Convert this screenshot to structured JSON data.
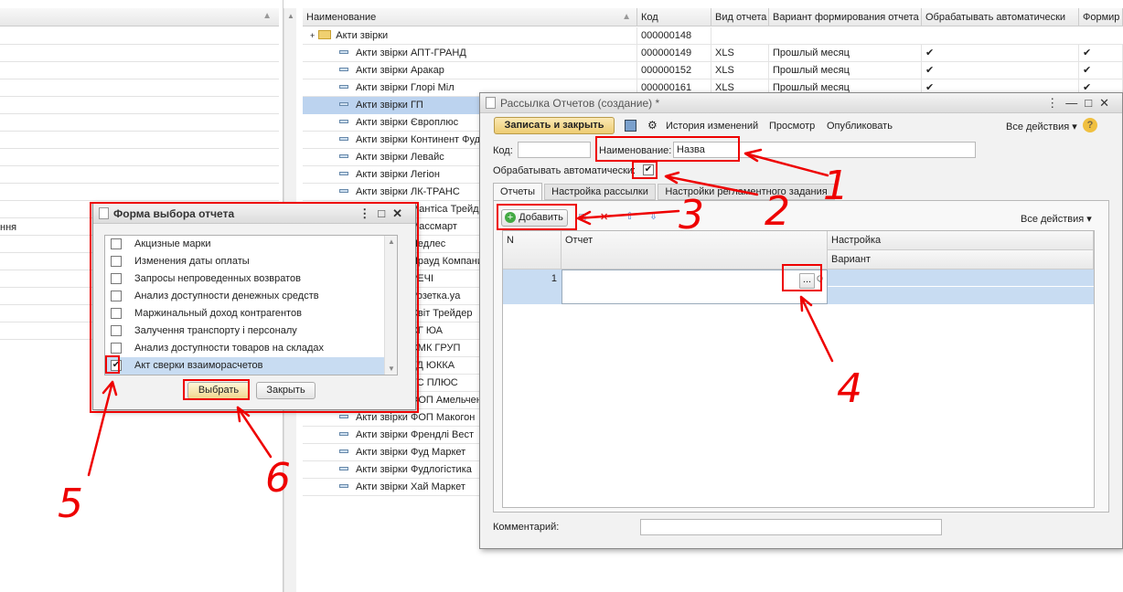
{
  "left_pane": {
    "partial_row_text": "ння"
  },
  "main_table": {
    "columns": [
      "Наименование",
      "Код",
      "Вид отчета",
      "Вариант формирования отчета",
      "Обрабатывать автоматически",
      "Формир"
    ],
    "folder": {
      "name": "Акти звірки",
      "code": "000000148"
    },
    "rows": [
      {
        "name": "Акти звірки АПТ-ГРАНД",
        "code": "000000149",
        "type": "XLS",
        "variant": "Прошлый месяц",
        "auto": "✔",
        "form": "✔"
      },
      {
        "name": "Акти звірки Аракар",
        "code": "000000152",
        "type": "XLS",
        "variant": "Прошлый месяц",
        "auto": "✔",
        "form": "✔"
      },
      {
        "name": "Акти звірки Глорі Міл",
        "code": "000000161",
        "type": "XLS",
        "variant": "Прошлый месяц",
        "auto": "✔",
        "form": "✔"
      },
      {
        "name": "Акти звірки ГП",
        "code": "",
        "type": "",
        "variant": "",
        "auto": "",
        "form": ""
      },
      {
        "name": "Акти звірки Європлюс",
        "code": "",
        "type": "",
        "variant": "",
        "auto": "",
        "form": ""
      },
      {
        "name": "Акти звірки Континент Фуд",
        "code": "",
        "type": "",
        "variant": "",
        "auto": "",
        "form": ""
      },
      {
        "name": "Акти звірки Левайс",
        "code": "",
        "type": "",
        "variant": "",
        "auto": "",
        "form": ""
      },
      {
        "name": "Акти звірки Легіон",
        "code": "",
        "type": "",
        "variant": "",
        "auto": "",
        "form": ""
      },
      {
        "name": "Акти звірки ЛК-ТРАНС",
        "code": "",
        "type": "",
        "variant": "",
        "auto": "",
        "form": ""
      },
      {
        "name": "Акти звірки Мантіса Трейд",
        "code": "",
        "type": "",
        "variant": "",
        "auto": "",
        "form": ""
      },
      {
        "name": "Акти звірки Массмарт",
        "code": "",
        "type": "",
        "variant": "",
        "auto": "",
        "form": ""
      },
      {
        "name": "Акти звірки Недлес",
        "code": "",
        "type": "",
        "variant": "",
        "auto": "",
        "form": ""
      },
      {
        "name": "Акти звірки Прауд Компани",
        "code": "",
        "type": "",
        "variant": "",
        "auto": "",
        "form": ""
      },
      {
        "name": "Акти звірки РЕЧІ",
        "code": "",
        "type": "",
        "variant": "",
        "auto": "",
        "form": ""
      },
      {
        "name": "Акти звірки Розетка.ya",
        "code": "",
        "type": "",
        "variant": "",
        "auto": "",
        "form": ""
      },
      {
        "name": "Акти звірки Світ Трейдер",
        "code": "",
        "type": "",
        "variant": "",
        "auto": "",
        "form": ""
      },
      {
        "name": "Акти звірки СГ ЮА",
        "code": "",
        "type": "",
        "variant": "",
        "auto": "",
        "form": ""
      },
      {
        "name": "Акти звірки СМК ГРУП",
        "code": "",
        "type": "",
        "variant": "",
        "auto": "",
        "form": ""
      },
      {
        "name": "Акти звірки ТД ЮККА",
        "code": "",
        "type": "",
        "variant": "",
        "auto": "",
        "form": ""
      },
      {
        "name": "Акти звірки ТС ПЛЮС",
        "code": "",
        "type": "",
        "variant": "",
        "auto": "",
        "form": ""
      },
      {
        "name": "Акти звірки ФОП Амельченко",
        "code": "",
        "type": "",
        "variant": "",
        "auto": "",
        "form": ""
      },
      {
        "name": "Акти звірки ФОП Макогон",
        "code": "",
        "type": "",
        "variant": "",
        "auto": "",
        "form": ""
      },
      {
        "name": "Акти звірки Френдлі Вест",
        "code": "",
        "type": "",
        "variant": "",
        "auto": "",
        "form": ""
      },
      {
        "name": "Акти звірки Фуд Маркет",
        "code": "",
        "type": "",
        "variant": "",
        "auto": "",
        "form": ""
      },
      {
        "name": "Акти звірки Фудлогістика",
        "code": "",
        "type": "",
        "variant": "",
        "auto": "",
        "form": ""
      },
      {
        "name": "Акти звірки Хай Маркет",
        "code": "",
        "type": "",
        "variant": "",
        "auto": "",
        "form": ""
      }
    ]
  },
  "mailing_window": {
    "title": "Рассылка Отчетов (создание) *",
    "toolbar": {
      "save_close": "Записать и закрыть",
      "history": "История изменений",
      "preview": "Просмотр",
      "publish": "Опубликовать",
      "all_actions": "Все действия ▾",
      "help": "?"
    },
    "code_label": "Код:",
    "code_value": "",
    "name_label": "Наименование:",
    "name_value": "Назва",
    "auto_label": "Обрабатывать автоматически:",
    "auto_checked": "✔",
    "tabs": [
      "Отчеты",
      "Настройка рассылки",
      "Настройки регламентного задания"
    ],
    "tab_toolbar": {
      "add": "Добавить",
      "all_actions": "Все действия ▾"
    },
    "table_headers": {
      "n": "N",
      "report": "Отчет",
      "settings": "Настройка",
      "variant": "Вариант"
    },
    "row": {
      "n": "1",
      "report": "",
      "select": "...",
      "search": "Q"
    },
    "comment_label": "Комментарий:",
    "comment_value": ""
  },
  "select_window": {
    "title": "Форма выбора отчета",
    "items": [
      {
        "label": "Акцизные марки",
        "checked": ""
      },
      {
        "label": "Изменения даты оплаты",
        "checked": ""
      },
      {
        "label": "Запросы непроведенных возвратов",
        "checked": ""
      },
      {
        "label": "Анализ доступности денежных средств",
        "checked": ""
      },
      {
        "label": "Маржинальный доход контрагентов",
        "checked": ""
      },
      {
        "label": "Залучення транспорту і персоналу",
        "checked": ""
      },
      {
        "label": "Анализ доступности товаров на складах",
        "checked": ""
      },
      {
        "label": "Акт сверки взаиморасчетов",
        "checked": "✔"
      }
    ],
    "select_button": "Выбрать",
    "close_button": "Закрыть"
  },
  "annotations": [
    "1",
    "2",
    "3",
    "4",
    "5",
    "6"
  ],
  "colors": {
    "selection": "#bcd3ef",
    "annotation": "#e00000",
    "accent_button": "#f5d98a"
  }
}
